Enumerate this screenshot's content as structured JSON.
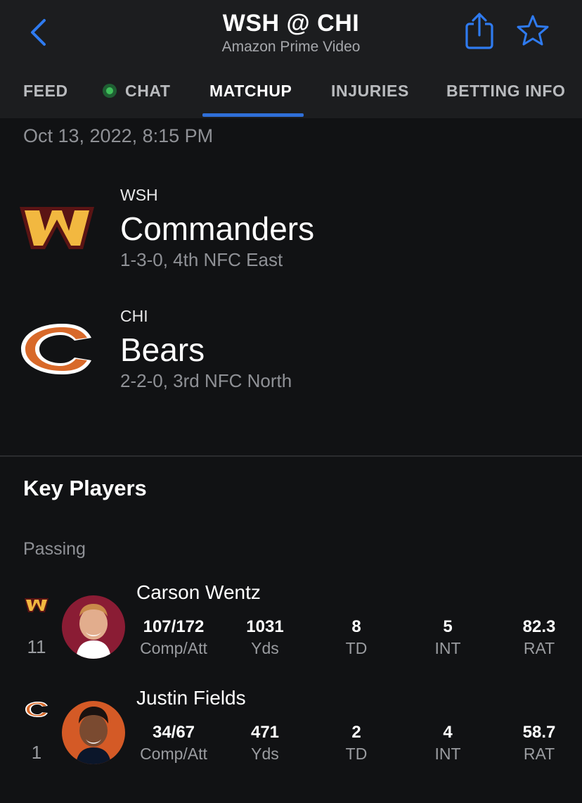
{
  "header": {
    "title": "WSH @ CHI",
    "subtitle": "Amazon Prime Video"
  },
  "tabs": [
    {
      "label": "FEED"
    },
    {
      "label": "CHAT"
    },
    {
      "label": "MATCHUP"
    },
    {
      "label": "INJURIES"
    },
    {
      "label": "BETTING INFO"
    }
  ],
  "active_tab": "MATCHUP",
  "colors": {
    "accent": "#2f6fd8",
    "live": "#3fbf5a",
    "commanders_gold": "#f2b840",
    "commanders_burgundy": "#5a1414",
    "bears_orange": "#d8692a",
    "bears_navy": "#0b162a"
  },
  "game": {
    "datetime": "Oct 13, 2022, 8:15 PM"
  },
  "teams": [
    {
      "abbr": "WSH",
      "name": "Commanders",
      "record": "1-3-0, 4th NFC East"
    },
    {
      "abbr": "CHI",
      "name": "Bears",
      "record": "2-2-0, 3rd NFC North"
    }
  ],
  "key_players": {
    "title": "Key Players",
    "category": "Passing",
    "players": [
      {
        "name": "Carson Wentz",
        "number": "11",
        "stats": [
          {
            "value": "107/172",
            "label": "Comp/Att"
          },
          {
            "value": "1031",
            "label": "Yds"
          },
          {
            "value": "8",
            "label": "TD"
          },
          {
            "value": "5",
            "label": "INT"
          },
          {
            "value": "82.3",
            "label": "RAT"
          }
        ]
      },
      {
        "name": "Justin Fields",
        "number": "1",
        "stats": [
          {
            "value": "34/67",
            "label": "Comp/Att"
          },
          {
            "value": "471",
            "label": "Yds"
          },
          {
            "value": "2",
            "label": "TD"
          },
          {
            "value": "4",
            "label": "INT"
          },
          {
            "value": "58.7",
            "label": "RAT"
          }
        ]
      }
    ]
  },
  "icons": [
    "back-chevron-icon",
    "share-icon",
    "star-icon",
    "live-dot-icon",
    "commanders-logo",
    "bears-logo"
  ]
}
